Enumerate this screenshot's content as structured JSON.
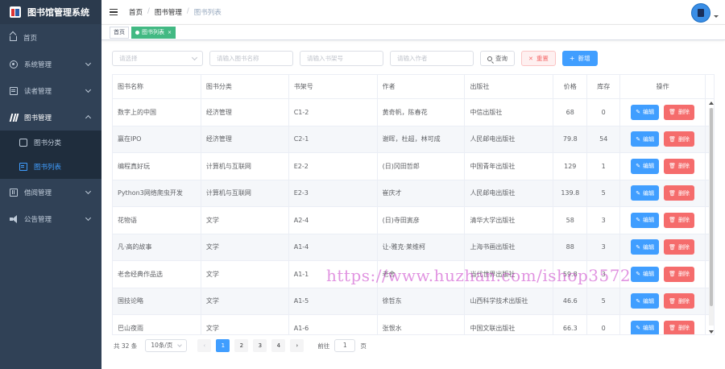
{
  "app": {
    "title": "图书馆管理系统"
  },
  "sidebar": {
    "items": [
      {
        "label": "首页",
        "icon": "home-icon"
      },
      {
        "label": "系统管理",
        "icon": "gear-icon"
      },
      {
        "label": "读者管理",
        "icon": "reader-icon"
      },
      {
        "label": "图书管理",
        "icon": "book-icon"
      },
      {
        "label": "借阅管理",
        "icon": "borrow-icon"
      },
      {
        "label": "公告管理",
        "icon": "notice-icon"
      }
    ],
    "sub": [
      {
        "label": "图书分类",
        "icon": "category-icon"
      },
      {
        "label": "图书列表",
        "icon": "list-icon"
      }
    ]
  },
  "breadcrumb": [
    "首页",
    "图书管理",
    "图书列表"
  ],
  "tags": [
    {
      "label": "首页"
    },
    {
      "label": "图书列表",
      "close": "×"
    }
  ],
  "filters": {
    "category_placeholder": "请选择",
    "name_placeholder": "请输入图书名称",
    "shelf_placeholder": "请输入书架号",
    "author_placeholder": "请输入作者",
    "search_label": "查询",
    "reset_label": "重置",
    "add_label": "新增",
    "reset_glyph": "✕",
    "add_glyph": "+"
  },
  "table": {
    "headers": [
      "图书名称",
      "图书分类",
      "书架号",
      "作者",
      "出版社",
      "价格",
      "库存",
      "操作"
    ],
    "edit_label": "编辑",
    "delete_label": "删除",
    "rows": [
      [
        "数字上的中国",
        "经济管理",
        "C1-2",
        "黄奇帆，陈春花",
        "中信出版社",
        "68",
        "0"
      ],
      [
        "赢在IPO",
        "经济管理",
        "C2-1",
        "谢晖，杜超，林可成",
        "人民邮电出版社",
        "79.8",
        "54"
      ],
      [
        "编程真好玩",
        "计算机与互联网",
        "E2-2",
        "(日)冈田哲郎",
        "中国青年出版社",
        "129",
        "1"
      ],
      [
        "Python3网络爬虫开发",
        "计算机与互联网",
        "E2-3",
        "崔庆才",
        "人民邮电出版社",
        "139.8",
        "5"
      ],
      [
        "花物语",
        "文学",
        "A2-4",
        "(日)寺田寅彦",
        "清华大学出版社",
        "58",
        "3"
      ],
      [
        "凡·高的故事",
        "文学",
        "A1-4",
        "让-雅克·莱维柯",
        "上海书画出版社",
        "88",
        "3"
      ],
      [
        "老舍经典作品选",
        "文学",
        "A1-1",
        "老舍",
        "当代世界出版社",
        "59.8",
        "3"
      ],
      [
        "国技论略",
        "文学",
        "A1-5",
        "徐哲东",
        "山西科学技术出版社",
        "46.6",
        "5"
      ],
      [
        "巴山夜雨",
        "文学",
        "A1-6",
        "张恨水",
        "中国文联出版社",
        "66.3",
        "0"
      ]
    ]
  },
  "pagination": {
    "total": "共 32 条",
    "page_size": "10条/页",
    "pages": [
      "1",
      "2",
      "3",
      "4"
    ],
    "current": "1",
    "goto_prefix": "前往",
    "goto_value": "1",
    "goto_suffix": "页",
    "prev_glyph": "‹",
    "next_glyph": "›"
  },
  "watermark": "https://www.huzhan.com/ishop3572",
  "colors": {
    "primary": "#409eff",
    "danger": "#f56c6c",
    "sidebar_bg": "#304156",
    "tag_active": "#42b983"
  }
}
